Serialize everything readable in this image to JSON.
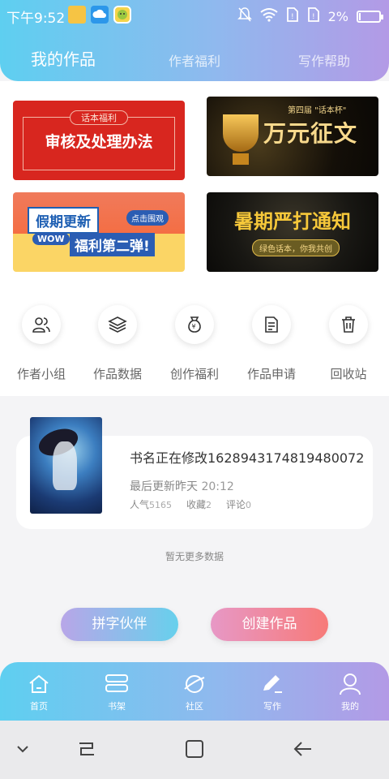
{
  "status_bar": {
    "time": "下午9:52",
    "battery_pct": "2%",
    "battery_level": 0.02,
    "left_icons": [
      "folder-icon",
      "weather-icon",
      "chat-app-icon"
    ],
    "right_icons": [
      "mute-bell-icon",
      "wifi-icon",
      "sim-icon",
      "sim-icon"
    ]
  },
  "tabs": [
    {
      "label": "我的作品",
      "active": true
    },
    {
      "label": "作者福利",
      "active": false
    },
    {
      "label": "写作帮助",
      "active": false
    }
  ],
  "banners": {
    "b1": {
      "tag": "话本福利",
      "title": "审核及处理办法"
    },
    "b2": {
      "sub": "第四届 \"话本杯\"",
      "title": "万元征文"
    },
    "b3": {
      "t1": "假期更新",
      "btn": "点击围观",
      "wow": "WOW",
      "t2": "福利第二弹!"
    },
    "b4": {
      "title": "暑期严打通知",
      "pill": "绿色话本，你我共创"
    }
  },
  "functions": [
    {
      "label": "作者小组",
      "icon": "user-group-icon"
    },
    {
      "label": "作品数据",
      "icon": "layers-icon"
    },
    {
      "label": "创作福利",
      "icon": "money-bag-icon"
    },
    {
      "label": "作品申请",
      "icon": "document-icon"
    },
    {
      "label": "回收站",
      "icon": "trash-icon"
    }
  ],
  "work": {
    "title": "书名正在修改1628943174819480072",
    "update_label": "最后更新昨天",
    "update_time": "20:12",
    "popularity_label": "人气",
    "popularity": "5165",
    "favorites_label": "收藏",
    "favorites": "2",
    "comments_label": "评论",
    "comments": "0"
  },
  "no_more": "暂无更多数据",
  "buttons": {
    "partner": "拼字伙伴",
    "create": "创建作品"
  },
  "bottom_nav": [
    {
      "label": "首页",
      "icon": "home-icon"
    },
    {
      "label": "书架",
      "icon": "bookshelf-icon"
    },
    {
      "label": "社区",
      "icon": "planet-icon"
    },
    {
      "label": "写作",
      "icon": "pen-icon"
    },
    {
      "label": "我的",
      "icon": "profile-icon"
    }
  ],
  "system_nav": [
    "chevron-down-icon",
    "recents-icon",
    "home-square-icon",
    "back-icon"
  ]
}
